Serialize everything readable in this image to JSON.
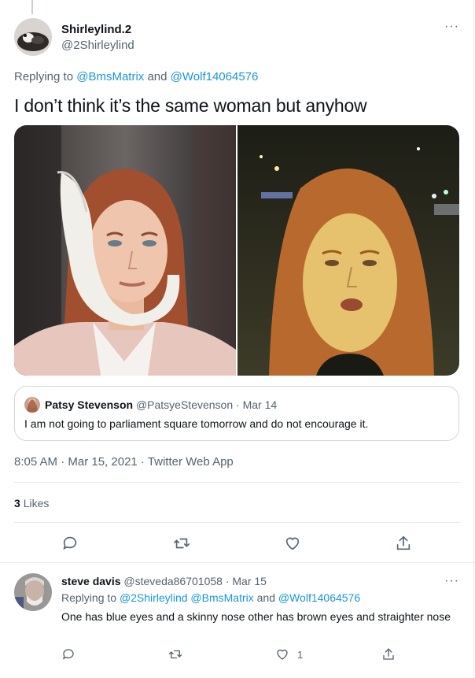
{
  "main_tweet": {
    "display_name": "Shirleylind.2",
    "handle": "@2Shirleylind",
    "more_label": "···",
    "replying_prefix": "Replying to",
    "replying_user1": "@BmsMatrix",
    "replying_and": "and",
    "replying_user2": "@Wolf14064576",
    "text": "I don’t think it’s the same woman but anyhow",
    "images": [
      {
        "icon": "photo-woman-head-bandage"
      },
      {
        "icon": "photo-woman-night-street"
      }
    ],
    "quoted": {
      "display_name": "Patsy Stevenson",
      "handle": "@PatsyeStevenson",
      "date": "· Mar 14",
      "text": "I am not going to parliament square tomorrow and do not encourage it."
    },
    "meta": "8:05 AM · Mar 15, 2021 · Twitter Web App",
    "likes_count": "3",
    "likes_label": "Likes",
    "actions": [
      {
        "icon": "reply-icon"
      },
      {
        "icon": "retweet-icon"
      },
      {
        "icon": "like-icon"
      },
      {
        "icon": "share-icon"
      }
    ]
  },
  "reply": {
    "display_name": "steve davis",
    "handle": "@steveda86701058",
    "date": "· Mar 15",
    "more_label": "···",
    "replying_prefix": "Replying to",
    "replying_users": "@2Shirleylind @BmsMatrix",
    "replying_and": "and",
    "replying_user_last": "@Wolf14064576",
    "text": "One has blue eyes and a skinny nose other has brown eyes and straighter nose",
    "like_count": "1"
  },
  "colors": {
    "link": "#1b95e0",
    "secondary_text": "#536471",
    "border": "#e6ecf0"
  }
}
